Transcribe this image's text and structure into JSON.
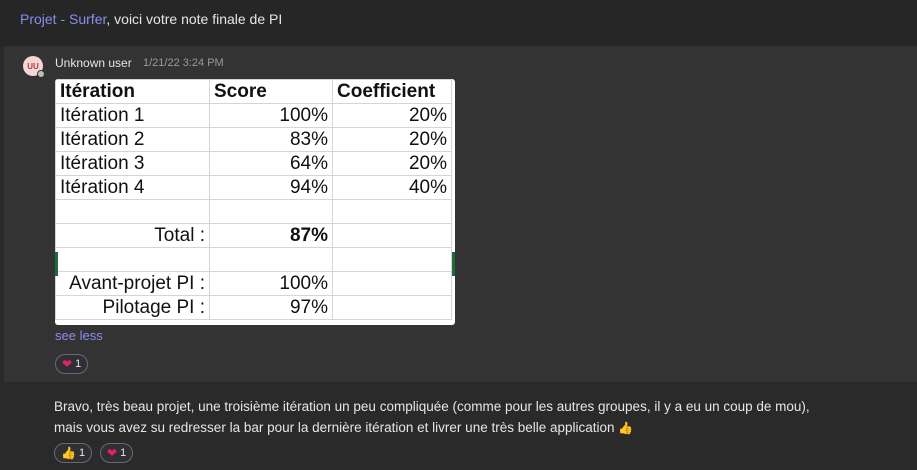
{
  "header_message": {
    "link_text": "Projet - Surfer",
    "rest_text": ", voici votre note finale de PI"
  },
  "post": {
    "avatar_initials": "UU",
    "username": "Unknown user",
    "timestamp": "1/21/22 3:24 PM",
    "image_table": {
      "headers": [
        "Itération",
        "Score",
        "Coefficient"
      ],
      "rows": [
        [
          "Itération 1",
          "100%",
          "20%"
        ],
        [
          "Itération 2",
          "83%",
          "20%"
        ],
        [
          "Itération 3",
          "64%",
          "20%"
        ],
        [
          "Itération 4",
          "94%",
          "40%"
        ]
      ],
      "total_label": "Total :",
      "total_value": "87%",
      "avant_projet_label": "Avant-projet PI :",
      "avant_projet_value": "100%",
      "pilotage_label": "Pilotage PI :",
      "pilotage_value": "97%"
    },
    "see_less": "see less",
    "reactions": [
      {
        "icon": "heart-icon",
        "count": "1"
      }
    ]
  },
  "reply": {
    "text_line1": "Bravo, très beau projet, une troisième itération un peu compliquée (comme pour les autres groupes, il y a eu un coup de mou),",
    "text_line2": "mais vous avez su redresser la bar pour la dernière itération et livrer une très belle application",
    "reactions": [
      {
        "icon": "thumbs-up-icon",
        "count": "1"
      },
      {
        "icon": "heart-icon",
        "count": "1"
      }
    ]
  },
  "colors": {
    "link": "#8b8cf0",
    "background": "#2a2a2a",
    "post_background": "#333333",
    "heart": "#e0245e"
  }
}
